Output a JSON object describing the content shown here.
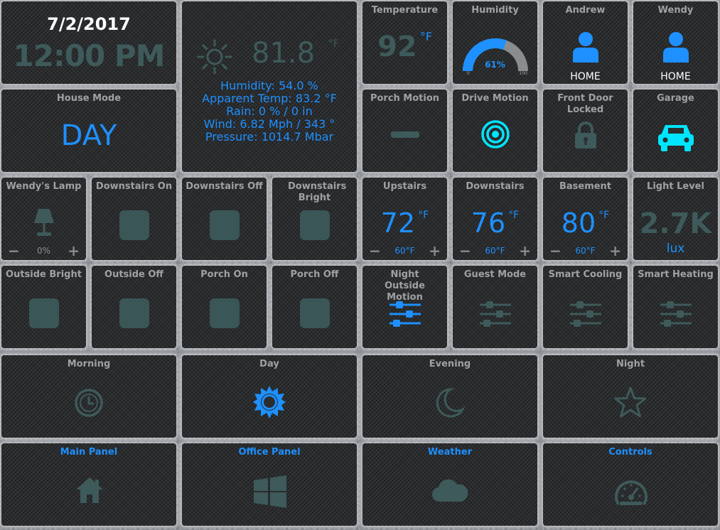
{
  "clock": {
    "date": "7/2/2017",
    "time": "12:00 PM"
  },
  "weather": {
    "temp": "81.8",
    "unit": "°F",
    "lines": [
      "Humidity:  54.0 %",
      "Apparent Temp:  83.2 °F",
      "Rain:  0  %  /  0 in",
      "Wind:  6.82  Mph  /  343  °",
      "Pressure:  1014.7  Mbar"
    ]
  },
  "temperature": {
    "title": "Temperature",
    "value": "92",
    "unit": "°F"
  },
  "humidity": {
    "title": "Humidity",
    "value": "61%",
    "level": 0.61,
    "min": "0",
    "max": "100"
  },
  "presence": [
    {
      "name": "Andrew",
      "status": "HOME"
    },
    {
      "name": "Wendy",
      "status": "HOME"
    }
  ],
  "house_mode": {
    "title": "House Mode",
    "value": "DAY"
  },
  "porch_motion": {
    "title": "Porch Motion"
  },
  "drive_motion": {
    "title": "Drive Motion"
  },
  "front_door": {
    "title": "Front Door Locked"
  },
  "garage": {
    "title": "Garage"
  },
  "wendys_lamp": {
    "title": "Wendy's Lamp",
    "level": "0%",
    "minus": "−",
    "plus": "+"
  },
  "switches_row3": [
    {
      "title": "Downstairs On"
    },
    {
      "title": "Downstairs Off"
    },
    {
      "title": "Downstairs Bright"
    }
  ],
  "thermostats": [
    {
      "title": "Upstairs",
      "value": "72",
      "unit": "°F",
      "setpoint": "60°F",
      "minus": "−",
      "plus": "+"
    },
    {
      "title": "Downstairs",
      "value": "76",
      "unit": "°F",
      "setpoint": "60°F",
      "minus": "−",
      "plus": "+"
    },
    {
      "title": "Basement",
      "value": "80",
      "unit": "°F",
      "setpoint": "60°F",
      "minus": "−",
      "plus": "+"
    }
  ],
  "light_level": {
    "title": "Light Level",
    "value": "2.7K",
    "unit": "lux"
  },
  "switches_row4": [
    {
      "title": "Outside Bright"
    },
    {
      "title": "Outside Off"
    },
    {
      "title": "Porch On"
    },
    {
      "title": "Porch Off"
    }
  ],
  "booleans": [
    {
      "title": "Night Outside Motion",
      "active": true
    },
    {
      "title": "Guest Mode",
      "active": false
    },
    {
      "title": "Smart Cooling",
      "active": false
    },
    {
      "title": "Smart Heating",
      "active": false
    }
  ],
  "modes": [
    {
      "title": "Morning"
    },
    {
      "title": "Day"
    },
    {
      "title": "Evening"
    },
    {
      "title": "Night"
    }
  ],
  "nav": [
    {
      "title": "Main Panel"
    },
    {
      "title": "Office Panel"
    },
    {
      "title": "Weather"
    },
    {
      "title": "Controls"
    }
  ],
  "colors": {
    "accent": "#1e90ff",
    "cyan": "#00e5ff",
    "inactive": "#3e5a5a",
    "title": "#9fa2a4"
  }
}
